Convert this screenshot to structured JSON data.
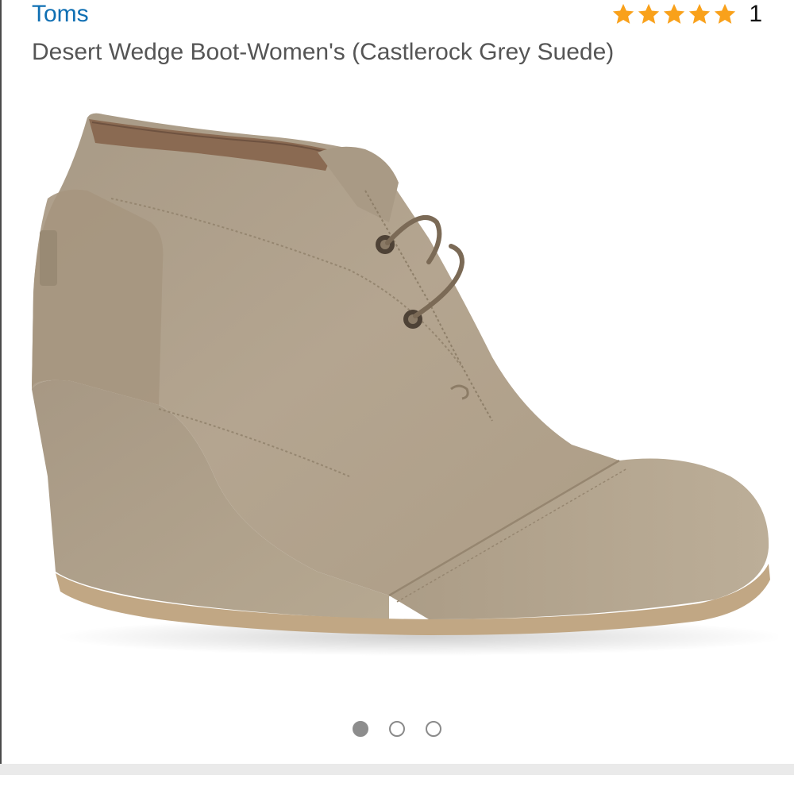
{
  "product": {
    "brand": "Toms",
    "title": "Desert Wedge Boot-Women's (Castlerock Grey Suede)",
    "rating": {
      "stars": 5,
      "max_stars": 5,
      "count": "1",
      "star_color": "#f9a11b"
    }
  },
  "image_carousel": {
    "image_alt": "suede-wedge-ankle-boot",
    "total": 3,
    "active_index": 0
  },
  "colors": {
    "brand_link": "#0f6fb3",
    "suede": "#b3a38c"
  }
}
